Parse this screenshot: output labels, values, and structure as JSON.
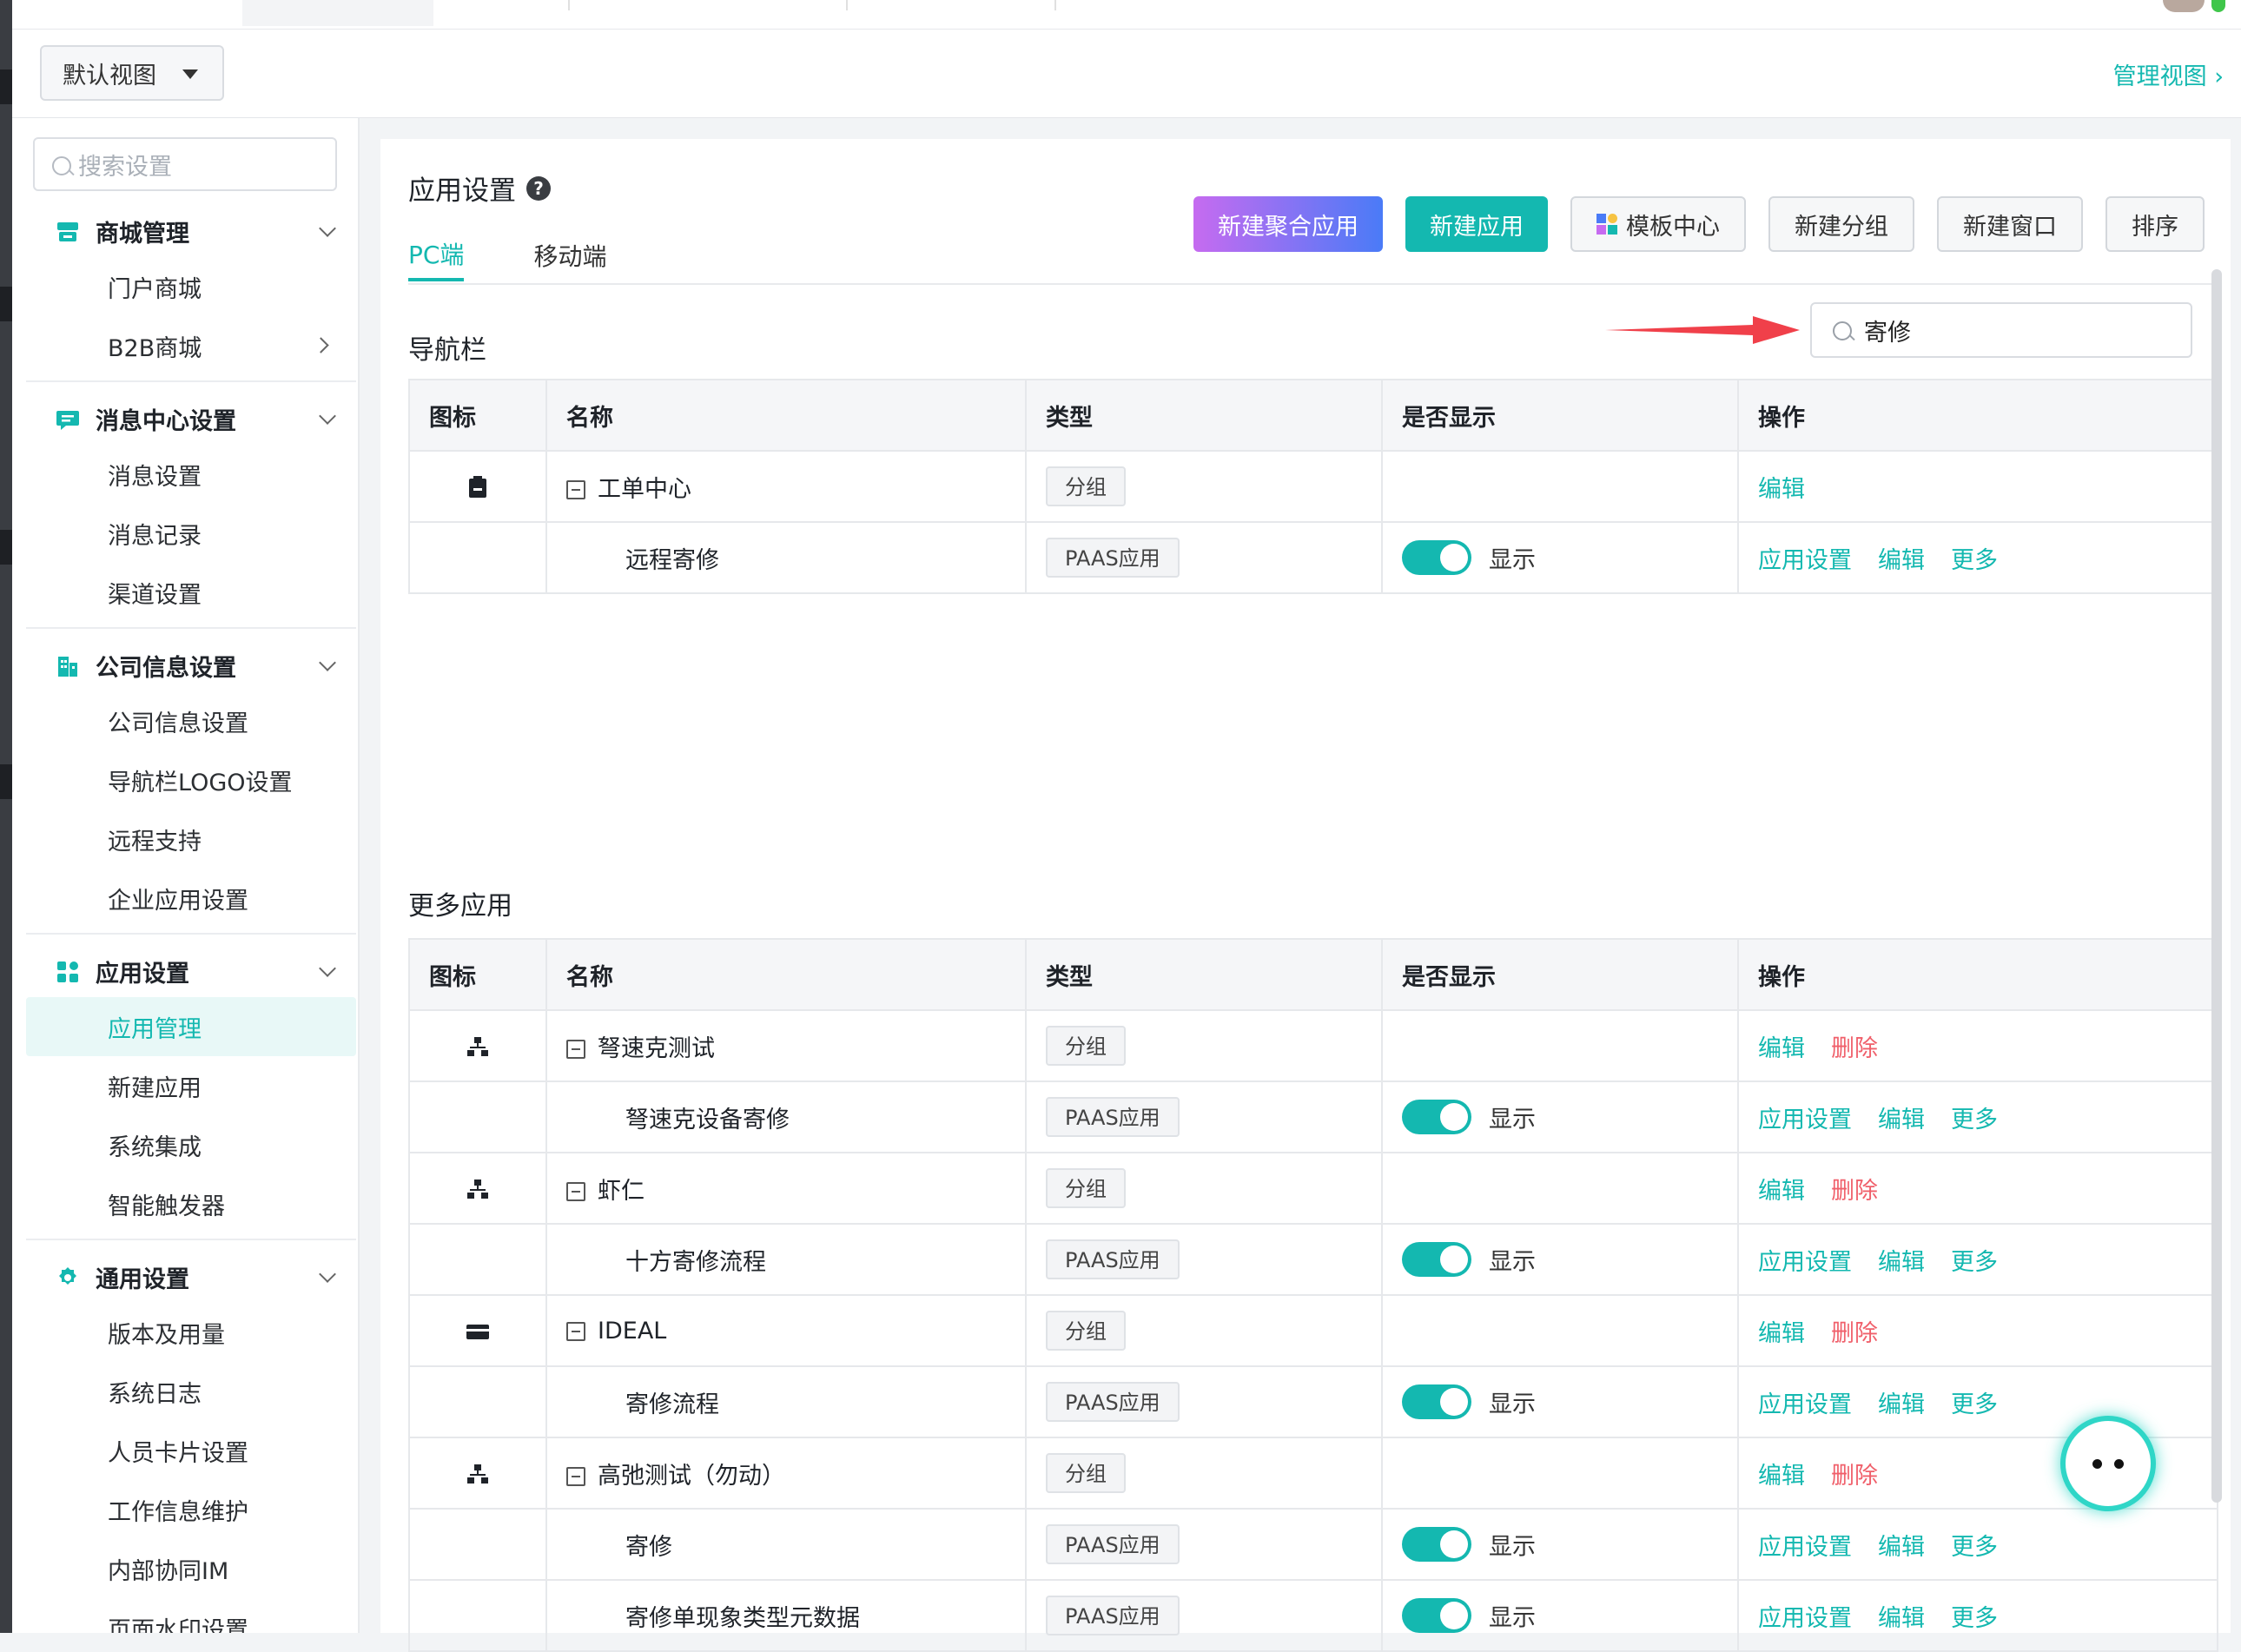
{
  "header": {
    "view_selector": "默认视图",
    "manage_view": "管理视图 ›"
  },
  "sidebar": {
    "search_placeholder": "搜索设置",
    "groups": [
      {
        "title": "商城管理",
        "items": [
          "门户商城",
          "B2B商城"
        ]
      },
      {
        "title": "消息中心设置",
        "items": [
          "消息设置",
          "消息记录",
          "渠道设置"
        ]
      },
      {
        "title": "公司信息设置",
        "items": [
          "公司信息设置",
          "导航栏LOGO设置",
          "远程支持",
          "企业应用设置"
        ]
      },
      {
        "title": "应用设置",
        "items": [
          "应用管理",
          "新建应用",
          "系统集成",
          "智能触发器"
        ]
      },
      {
        "title": "通用设置",
        "items": [
          "版本及用量",
          "系统日志",
          "人员卡片设置",
          "工作信息维护",
          "内部协同IM",
          "页面水印设置"
        ]
      }
    ]
  },
  "main": {
    "title": "应用设置",
    "help_mark": "?",
    "tabs": [
      "PC端",
      "移动端"
    ],
    "buttons": {
      "new_aggregate": "新建聚合应用",
      "new_app": "新建应用",
      "template_center": "模板中心",
      "new_group": "新建分组",
      "new_window": "新建窗口",
      "sort": "排序"
    },
    "filter_value": "寄修",
    "columns": [
      "图标",
      "名称",
      "类型",
      "是否显示",
      "操作"
    ],
    "nav_section": {
      "title": "导航栏",
      "rows": [
        {
          "name": "工单中心",
          "type": "分组",
          "ops": [
            "编辑"
          ]
        },
        {
          "name": "远程寄修",
          "type": "PAAS应用",
          "show": "显示",
          "ops": [
            "应用设置",
            "编辑",
            "更多"
          ]
        }
      ]
    },
    "more_section": {
      "title": "更多应用",
      "rows": [
        {
          "name": "弩速克测试",
          "type": "分组",
          "ops": [
            "编辑"
          ],
          "del": "删除"
        },
        {
          "name": "弩速克设备寄修",
          "type": "PAAS应用",
          "show": "显示",
          "ops": [
            "应用设置",
            "编辑",
            "更多"
          ]
        },
        {
          "name": "虾仁",
          "type": "分组",
          "ops": [
            "编辑"
          ],
          "del": "删除"
        },
        {
          "name": "十方寄修流程",
          "type": "PAAS应用",
          "show": "显示",
          "ops": [
            "应用设置",
            "编辑",
            "更多"
          ]
        },
        {
          "name": "IDEAL",
          "type": "分组",
          "ops": [
            "编辑"
          ],
          "del": "删除"
        },
        {
          "name": "寄修流程",
          "type": "PAAS应用",
          "show": "显示",
          "ops": [
            "应用设置",
            "编辑",
            "更多"
          ]
        },
        {
          "name": "高弛测试（勿动）",
          "type": "分组",
          "ops": [
            "编辑"
          ],
          "del": "删除"
        },
        {
          "name": "寄修",
          "type": "PAAS应用",
          "show": "显示",
          "ops": [
            "应用设置",
            "编辑",
            "更多"
          ]
        },
        {
          "name": "寄修单现象类型元数据",
          "type": "PAAS应用",
          "show": "显示",
          "ops": [
            "应用设置",
            "编辑",
            "更多"
          ]
        }
      ]
    }
  },
  "colors": {
    "accent": "#14b8b0",
    "delete": "#f0606b",
    "arrow": "#f0404a"
  }
}
